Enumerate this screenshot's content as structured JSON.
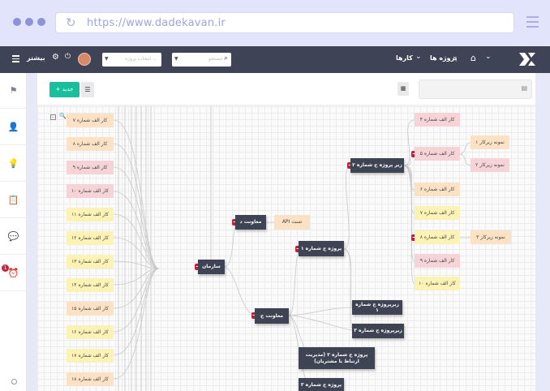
{
  "browser": {
    "url": "https://www.dadekavan.ir"
  },
  "header": {
    "more_label": "بیشتر",
    "select_placeholder": "انتخاب پروژه ...",
    "search_placeholder": "جستجو",
    "nav_tasks": "کارها",
    "nav_projects": "پروژه ها"
  },
  "sidebar": {
    "badge_count": "1"
  },
  "toolbar": {
    "new_label": "+ جدید"
  },
  "colors": {
    "accent": "#19be9c",
    "dark_node": "#3f4455",
    "collapse": "#c41e36",
    "header": "#3e4456"
  },
  "chart": {
    "root": "سازمان",
    "deputy_d": "معاونت د",
    "api_test": "API تست",
    "deputy_j": "معاونت ج",
    "project_j1": "پروژه ج شماره ۱",
    "subproject_j1": "زیرپروژه ج شماره ۱",
    "subproject_j3": "زیرپروژه ج شماره ۳",
    "project_j2": "پروژه ج شماره ۲ (مدیریت ارتباط با مشتریان)",
    "project_j3": "پروژه ج شماره ۳",
    "sub_project_j2": "زیر پروژه ج شماره ۲",
    "left_tasks": [
      "کار الف شماره ۷",
      "کار الف شماره ۸",
      "کار الف شماره ۹",
      "کار الف شماره ۱۰",
      "کار الف شماره ۱۱",
      "کار الف شماره ۱۲",
      "کار الف شماره ۱۳",
      "کار الف شماره ۱۴",
      "کار الف شماره ۱۵",
      "کار الف شماره ۱۶",
      "کار الف شماره ۱۷",
      "کار الف شماره ۱۸"
    ],
    "right_tasks": [
      "کار الف شماره ۴",
      "کار الف شماره ۵",
      "کار الف شماره ۶",
      "کار الف شماره ۷",
      "کار الف شماره ۸",
      "کار الف شماره ۹",
      "کار الف شماره ۱۰"
    ],
    "samples": {
      "s1": "نمونه زیرکار ۱",
      "s2": "نمونه زیرکار ۲",
      "s3": "نمونه زیرکار ۳"
    }
  }
}
